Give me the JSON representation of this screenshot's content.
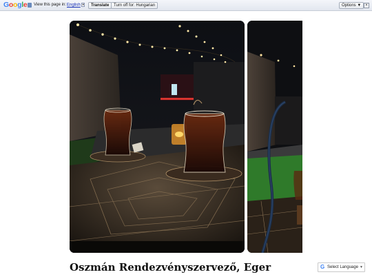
{
  "translate_bar": {
    "logo": [
      "G",
      "o",
      "o",
      "g",
      "l",
      "e"
    ],
    "logo_colors": [
      "#4285f4",
      "#ea4335",
      "#fbbc05",
      "#4285f4",
      "#34a853",
      "#ea4335"
    ],
    "view_text": "View this page in:",
    "language": "English",
    "translate_button": "Translate",
    "turn_off_button": "Turn off for: Hungarian",
    "options_button": "Options ▼",
    "close_label": "×"
  },
  "gallery": {
    "photos": [
      {
        "alt": "Tea glasses on an ornate table at night"
      },
      {
        "alt": "Hookah and tea on a terrace at night"
      }
    ]
  },
  "page": {
    "title": "Oszmán Rendezvényszervező, Eger"
  },
  "translate_widget": {
    "g_letter": "G",
    "label": "Select Language",
    "arrow": "▼"
  }
}
